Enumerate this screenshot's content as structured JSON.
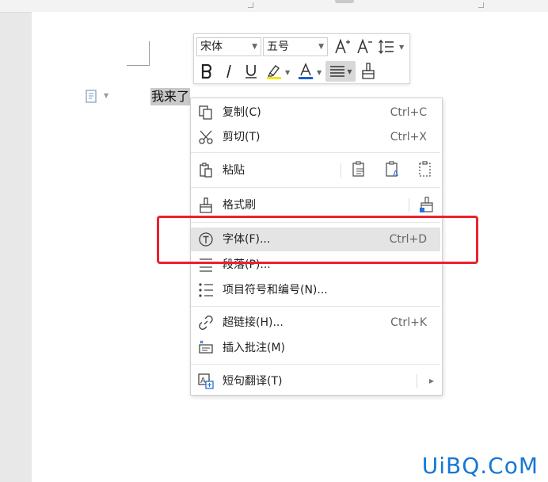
{
  "document": {
    "selected_text": "我来了"
  },
  "mini_toolbar": {
    "font_name": "宋体",
    "font_size": "五号"
  },
  "context_menu": {
    "items": [
      {
        "label": "复制(C)",
        "shortcut": "Ctrl+C",
        "icon": "copy-icon"
      },
      {
        "label": "剪切(T)",
        "shortcut": "Ctrl+X",
        "icon": "cut-icon"
      },
      {
        "label": "粘贴",
        "shortcut": "",
        "icon": "paste-icon"
      },
      {
        "label": "格式刷",
        "shortcut": "",
        "icon": "format-painter-icon"
      },
      {
        "label": "字体(F)...",
        "shortcut": "Ctrl+D",
        "icon": "font-icon"
      },
      {
        "label": "段落(P)...",
        "shortcut": "",
        "icon": "paragraph-icon"
      },
      {
        "label": "项目符号和编号(N)...",
        "shortcut": "",
        "icon": "bullet-list-icon"
      },
      {
        "label": "超链接(H)...",
        "shortcut": "Ctrl+K",
        "icon": "hyperlink-icon"
      },
      {
        "label": "插入批注(M)",
        "shortcut": "",
        "icon": "comment-icon"
      },
      {
        "label": "短句翻译(T)",
        "shortcut": "",
        "icon": "translate-icon"
      }
    ]
  },
  "watermark": "UiBQ.CoM",
  "colors": {
    "highlight_box": "#e8232d",
    "watermark": "#1578d6",
    "menu_hover": "#e4e4e4"
  }
}
